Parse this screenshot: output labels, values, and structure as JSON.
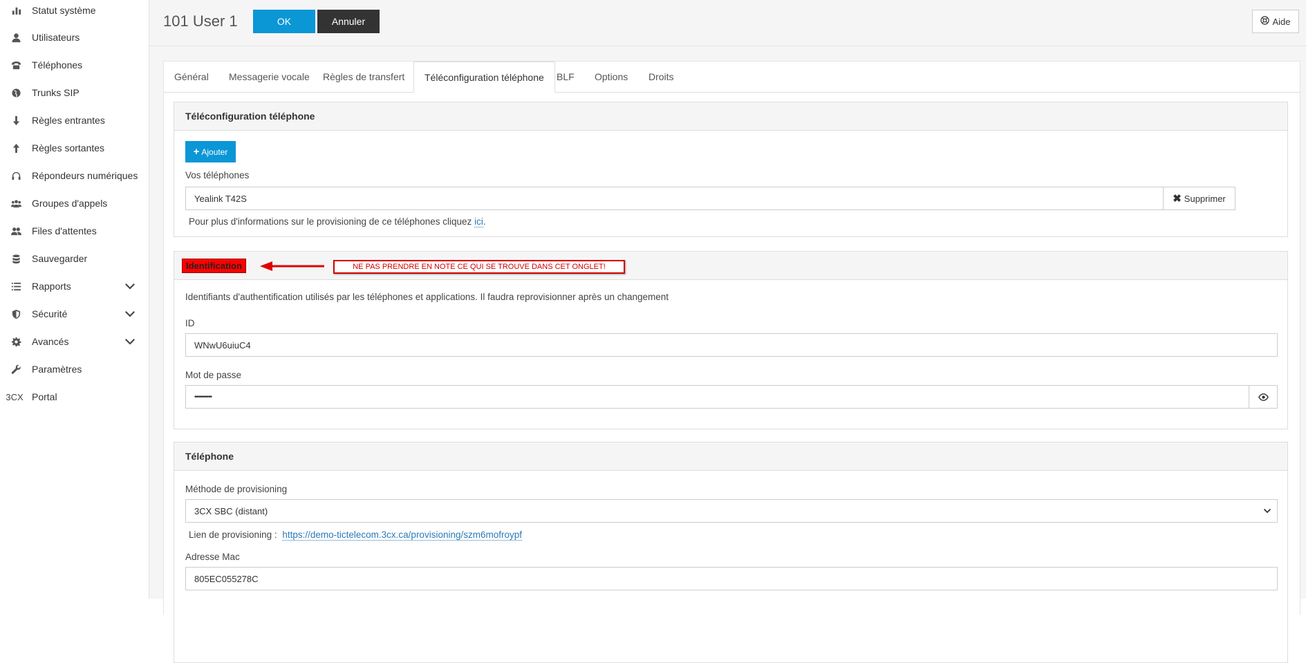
{
  "sidebar": {
    "items": [
      {
        "label": "Statut système",
        "icon": "bar-chart-icon"
      },
      {
        "label": "Utilisateurs",
        "icon": "user-icon"
      },
      {
        "label": "Téléphones",
        "icon": "phone-icon"
      },
      {
        "label": "Trunks SIP",
        "icon": "globe-icon"
      },
      {
        "label": "Règles entrantes",
        "icon": "arrow-down-icon"
      },
      {
        "label": "Règles sortantes",
        "icon": "arrow-up-icon"
      },
      {
        "label": "Répondeurs numériques",
        "icon": "headset-icon"
      },
      {
        "label": "Groupes d'appels",
        "icon": "group-icon"
      },
      {
        "label": "Files d'attentes",
        "icon": "users-icon"
      },
      {
        "label": "Sauvegarder",
        "icon": "database-icon"
      },
      {
        "label": "Rapports",
        "icon": "list-icon"
      },
      {
        "label": "Sécurité",
        "icon": "shield-icon"
      },
      {
        "label": "Avancés",
        "icon": "gear-icon"
      },
      {
        "label": "Paramètres",
        "icon": "wrench-icon"
      },
      {
        "label": "Portal",
        "icon": "3cx-logo"
      }
    ],
    "logo_text": "3CX"
  },
  "header": {
    "title": "101 User 1",
    "ok_label": "OK",
    "cancel_label": "Annuler",
    "help_label": "Aide"
  },
  "tabs": [
    {
      "label": "Général"
    },
    {
      "label": "Messagerie vocale"
    },
    {
      "label": "Règles de transfert"
    },
    {
      "label": "Téléconfiguration téléphone",
      "active": true
    },
    {
      "label": "BLF"
    },
    {
      "label": "Options"
    },
    {
      "label": "Droits"
    }
  ],
  "provisioning": {
    "heading": "Téléconfiguration téléphone",
    "add_label": "Ajouter",
    "phones_label": "Vos téléphones",
    "selected_phone": "Yealink T42S",
    "delete_label": "Supprimer",
    "info_text": "Pour plus d'informations sur le provisioning de ce téléphones cliquez",
    "info_link": "ici",
    "info_end": "."
  },
  "identification": {
    "heading": "Identification",
    "annotation": "NE PAS PRENDRE EN NOTE CE QUI SE TROUVE DANS CET ONGLET!",
    "description": "Identifiants d'authentification utilisés par les téléphones et applications. Il faudra reprovisionner après un changement",
    "id_label": "ID",
    "id_value": "WNwU6uiuC4",
    "password_label": "Mot de passe",
    "password_value": "••••••••••"
  },
  "telephone": {
    "heading": "Téléphone",
    "method_label": "Méthode de provisioning",
    "method_value": "3CX SBC (distant)",
    "link_label": "Lien de provisioning :",
    "link_value": "https://demo-tictelecom.3cx.ca/provisioning/szm6mofroypf",
    "mac_label": "Adresse Mac",
    "mac_value": "805EC055278C"
  },
  "colors": {
    "accent": "#0b96d6",
    "dark_button": "#333333",
    "annotation_red": "#ff0000"
  }
}
